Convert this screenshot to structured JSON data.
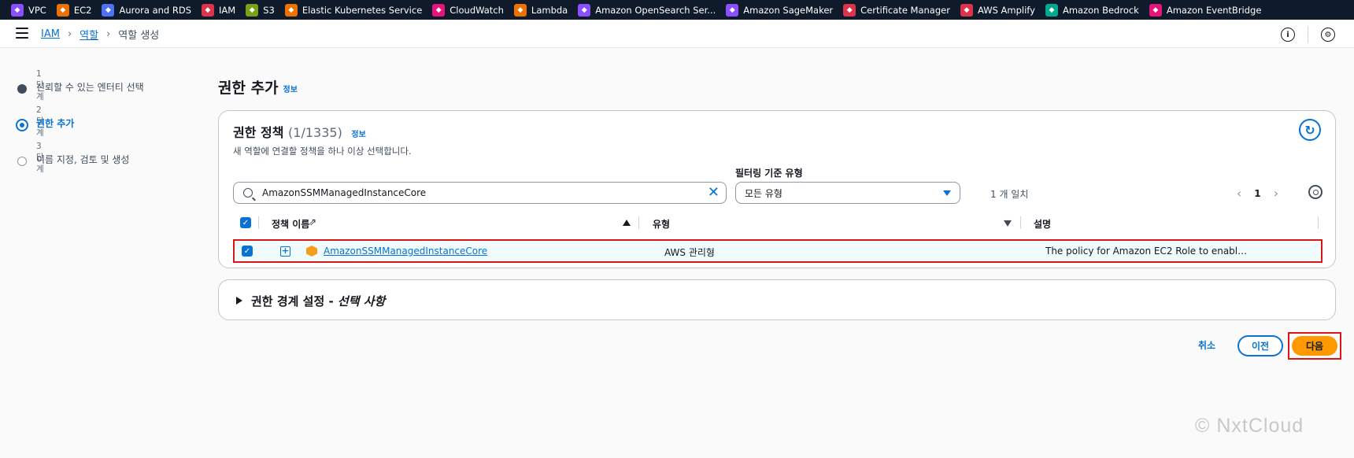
{
  "favorites": [
    {
      "label": "VPC",
      "icon": "vpc-icon",
      "color": "#8c4fff"
    },
    {
      "label": "EC2",
      "icon": "ec2-icon",
      "color": "#ed7100"
    },
    {
      "label": "Aurora and RDS",
      "icon": "rds-icon",
      "color": "#4d72f3"
    },
    {
      "label": "IAM",
      "icon": "iam-icon",
      "color": "#dd344c"
    },
    {
      "label": "S3",
      "icon": "s3-icon",
      "color": "#7aa116"
    },
    {
      "label": "Elastic Kubernetes Service",
      "icon": "eks-icon",
      "color": "#ed7100"
    },
    {
      "label": "CloudWatch",
      "icon": "cloudwatch-icon",
      "color": "#e7157b"
    },
    {
      "label": "Lambda",
      "icon": "lambda-icon",
      "color": "#ed7100"
    },
    {
      "label": "Amazon OpenSearch Ser...",
      "icon": "opensearch-icon",
      "color": "#8c4fff"
    },
    {
      "label": "Amazon SageMaker",
      "icon": "sagemaker-icon",
      "color": "#8c4fff"
    },
    {
      "label": "Certificate Manager",
      "icon": "certificate-icon",
      "color": "#dd344c"
    },
    {
      "label": "AWS Amplify",
      "icon": "amplify-icon",
      "color": "#dd344c"
    },
    {
      "label": "Amazon Bedrock",
      "icon": "bedrock-icon",
      "color": "#01a88d"
    },
    {
      "label": "Amazon EventBridge",
      "icon": "eventbridge-icon",
      "color": "#e7157b"
    }
  ],
  "breadcrumb": {
    "root": "IAM",
    "parent": "역할",
    "current": "역할 생성"
  },
  "steps": [
    {
      "num": "1단계",
      "label": "신뢰할 수 있는 엔터티 선택",
      "state": "done"
    },
    {
      "num": "2단계",
      "label": "권한 추가",
      "state": "active"
    },
    {
      "num": "3단계",
      "label": "이름 지정, 검토 및 생성",
      "state": "todo"
    }
  ],
  "page": {
    "title": "권한 추가",
    "info": "정보"
  },
  "policies": {
    "title": "권한 정책",
    "count": "(1/1335)",
    "info": "정보",
    "description": "새 역할에 연결할 정책을 하나 이상 선택합니다.",
    "filter_label": "필터링 기준 유형",
    "search_value": "AmazonSSMManagedInstanceCore",
    "filter_value": "모든 유형",
    "matches": "1 개 일치",
    "page": "1",
    "columns": {
      "name": "정책 이름",
      "type": "유형",
      "description": "설명"
    },
    "rows": [
      {
        "name": "AmazonSSMManagedInstanceCore",
        "type": "AWS 관리형",
        "description": "The policy for Amazon EC2 Role to enabl…"
      }
    ]
  },
  "boundary": {
    "title": "권한 경계 설정 - ",
    "optional": "선택 사항"
  },
  "actions": {
    "cancel": "취소",
    "prev": "이전",
    "next": "다음"
  },
  "watermark": "© NxtCloud"
}
